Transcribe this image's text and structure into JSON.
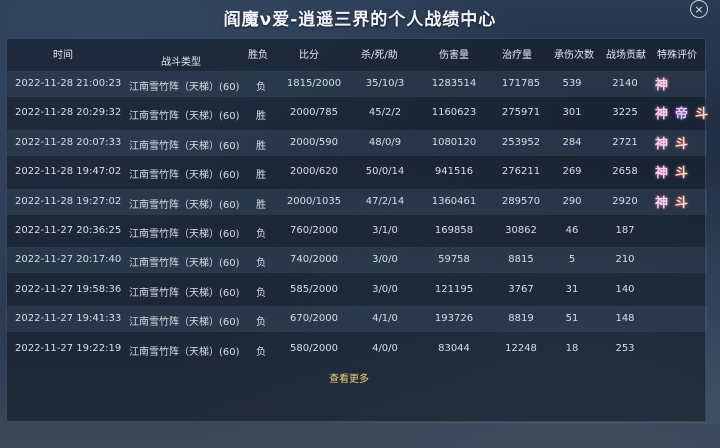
{
  "title": "阎魔ν爱-逍遥三界的个人战绩中心",
  "close_label": "×",
  "headers": {
    "time": "时间",
    "battle_type": "战斗类型",
    "result": "胜负",
    "score": "比分",
    "kda": "杀/死/助",
    "damage": "伤害量",
    "healing": "治疗量",
    "hits_taken": "承伤次数",
    "contribution": "战场贡献",
    "special": "特殊评价"
  },
  "rows": [
    {
      "time": "2022-11-28 21:00:23",
      "type": "江南雪竹阵（天梯）(60)",
      "result": "负",
      "score": "1815/2000",
      "kda": "35/10/3",
      "damage": "1283514",
      "healing": "171785",
      "hits": "539",
      "contrib": "2140",
      "badges": [
        "神"
      ]
    },
    {
      "time": "2022-11-28 20:29:32",
      "type": "江南雪竹阵（天梯）(60)",
      "result": "胜",
      "score": "2000/785",
      "kda": "45/2/2",
      "damage": "1160623",
      "healing": "275971",
      "hits": "301",
      "contrib": "3225",
      "badges": [
        "神",
        "帝",
        "斗"
      ]
    },
    {
      "time": "2022-11-28 20:07:33",
      "type": "江南雪竹阵（天梯）(60)",
      "result": "胜",
      "score": "2000/590",
      "kda": "48/0/9",
      "damage": "1080120",
      "healing": "253952",
      "hits": "284",
      "contrib": "2721",
      "badges": [
        "神",
        "斗"
      ]
    },
    {
      "time": "2022-11-28 19:47:02",
      "type": "江南雪竹阵（天梯）(60)",
      "result": "胜",
      "score": "2000/620",
      "kda": "50/0/14",
      "damage": "941516",
      "healing": "276211",
      "hits": "269",
      "contrib": "2658",
      "badges": [
        "神",
        "斗"
      ]
    },
    {
      "time": "2022-11-28 19:27:02",
      "type": "江南雪竹阵（天梯）(60)",
      "result": "胜",
      "score": "2000/1035",
      "kda": "47/2/14",
      "damage": "1360461",
      "healing": "289570",
      "hits": "290",
      "contrib": "2920",
      "badges": [
        "神",
        "斗"
      ]
    },
    {
      "time": "2022-11-27 20:36:25",
      "type": "江南雪竹阵（天梯）(60)",
      "result": "负",
      "score": "760/2000",
      "kda": "3/1/0",
      "damage": "169858",
      "healing": "30862",
      "hits": "46",
      "contrib": "187",
      "badges": []
    },
    {
      "time": "2022-11-27 20:17:40",
      "type": "江南雪竹阵（天梯）(60)",
      "result": "负",
      "score": "740/2000",
      "kda": "3/0/0",
      "damage": "59758",
      "healing": "8815",
      "hits": "5",
      "contrib": "210",
      "badges": []
    },
    {
      "time": "2022-11-27 19:58:36",
      "type": "江南雪竹阵（天梯）(60)",
      "result": "负",
      "score": "585/2000",
      "kda": "3/0/0",
      "damage": "121195",
      "healing": "3767",
      "hits": "31",
      "contrib": "140",
      "badges": []
    },
    {
      "time": "2022-11-27 19:41:33",
      "type": "江南雪竹阵（天梯）(60)",
      "result": "负",
      "score": "670/2000",
      "kda": "4/1/0",
      "damage": "193726",
      "healing": "8819",
      "hits": "51",
      "contrib": "148",
      "badges": []
    },
    {
      "time": "2022-11-27 19:22:19",
      "type": "江南雪竹阵（天梯）(60)",
      "result": "负",
      "score": "580/2000",
      "kda": "4/0/0",
      "damage": "83044",
      "healing": "12248",
      "hits": "18",
      "contrib": "253",
      "badges": []
    }
  ],
  "more_label": "查看更多"
}
